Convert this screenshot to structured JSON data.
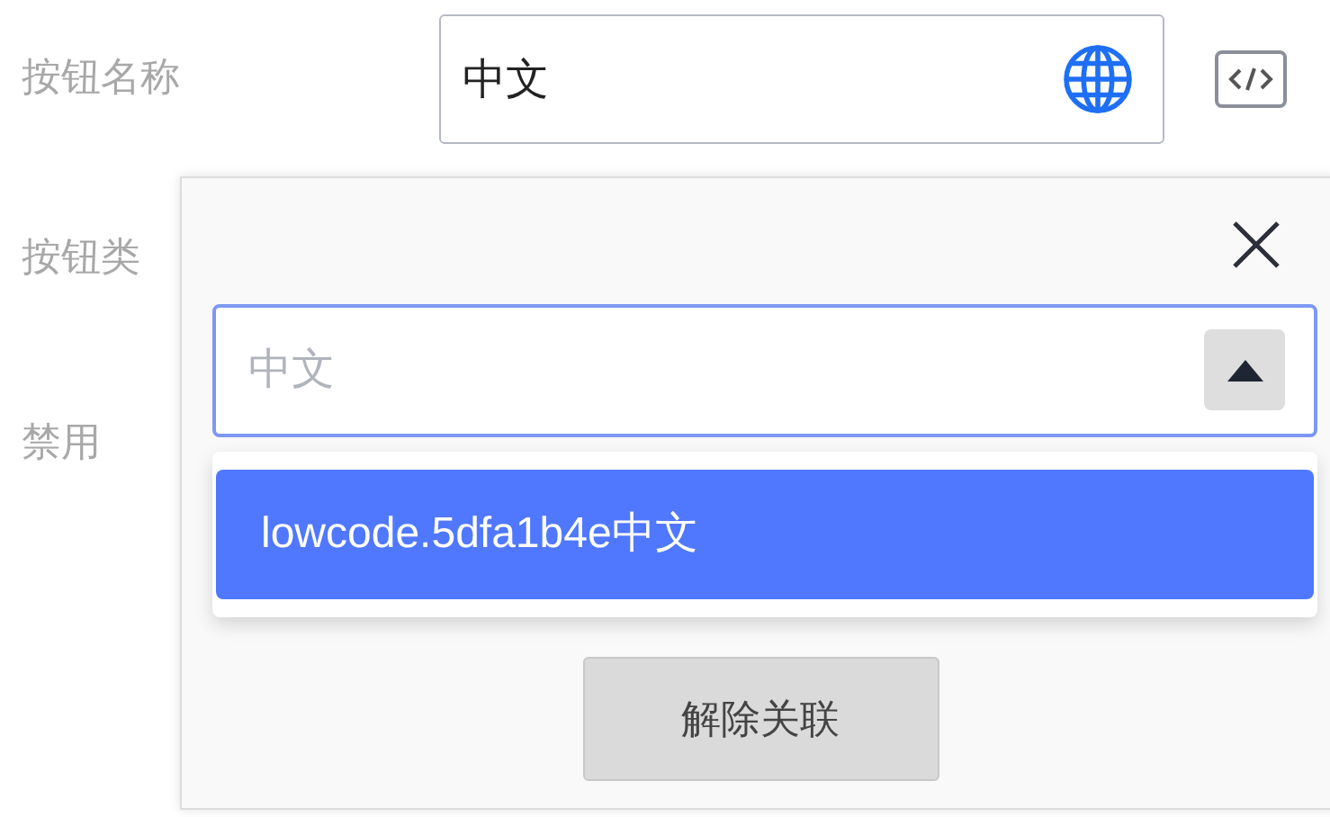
{
  "form": {
    "fields": [
      {
        "label": "按钮名称"
      },
      {
        "label": "按钮类"
      },
      {
        "label": "禁用"
      }
    ],
    "name_input": {
      "value": "中文"
    }
  },
  "popup": {
    "search": {
      "placeholder": "中文",
      "expanded": true
    },
    "options": [
      {
        "label": "lowcode.5dfa1b4e中文",
        "selected": true
      }
    ],
    "unlink_button": "解除关联"
  }
}
